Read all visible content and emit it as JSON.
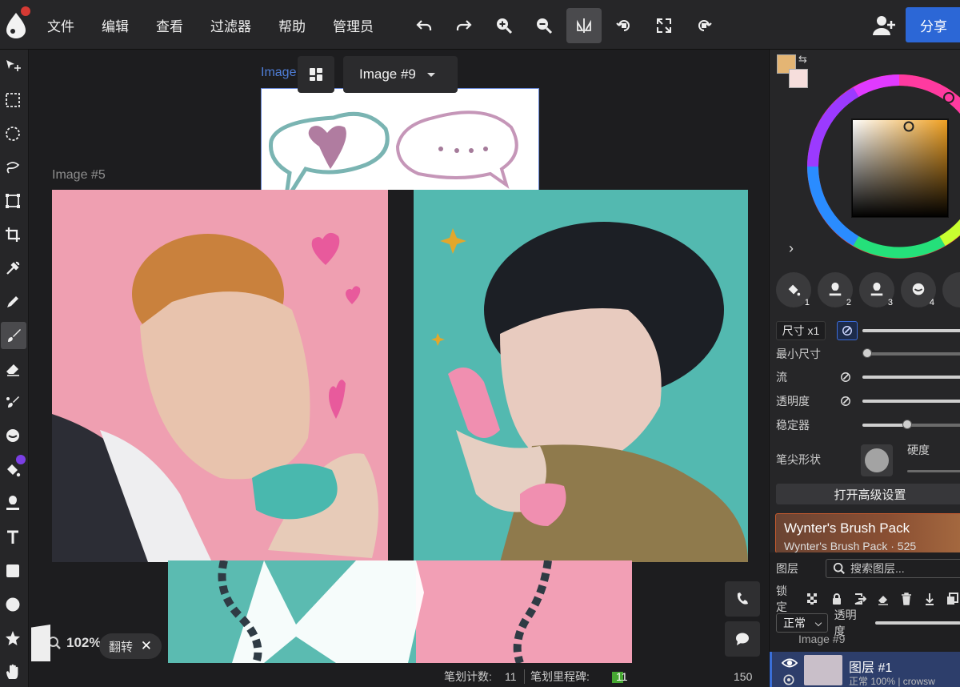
{
  "menu": [
    "文件",
    "编辑",
    "查看",
    "过滤器",
    "帮助",
    "管理员"
  ],
  "share_label": "分享",
  "canvas": {
    "image5_label": "Image #5",
    "image9_label": "Image",
    "image9_select": "Image #9",
    "zoom": "102%",
    "flip_label": "翻转",
    "flip_close": "✕"
  },
  "status": {
    "stroke_count_label": "笔划计数:",
    "stroke_count": "11",
    "milestone_label": "笔划里程碑:",
    "milestone_value": "11",
    "milestone_max": "150"
  },
  "colors": {
    "primary": "#e4b574",
    "secondary": "#f6dedc",
    "accent": "#2c67d6"
  },
  "brush": {
    "presets": [
      "1",
      "2",
      "3",
      "4"
    ],
    "size_label": "尺寸 x1",
    "min_size_label": "最小尺寸",
    "flow_label": "流",
    "opacity_label": "透明度",
    "stabilizer_label": "稳定器",
    "tip_shape_label": "笔尖形状",
    "hardness_label": "硬度",
    "advanced_button": "打开高级设置",
    "stabilizer_level": 0.45
  },
  "brush_pack": {
    "title": "Wynter's Brush Pack",
    "subtitle": "Wynter's Brush Pack · 525"
  },
  "layers": {
    "title": "图层",
    "search_placeholder": "搜索图层...",
    "lock_label": "锁定",
    "blend_mode": "正常",
    "opacity_label": "透明度",
    "group_label": "Image #9",
    "layer_name": "图层 #1",
    "layer_meta": "正常 100% | crowsw"
  }
}
